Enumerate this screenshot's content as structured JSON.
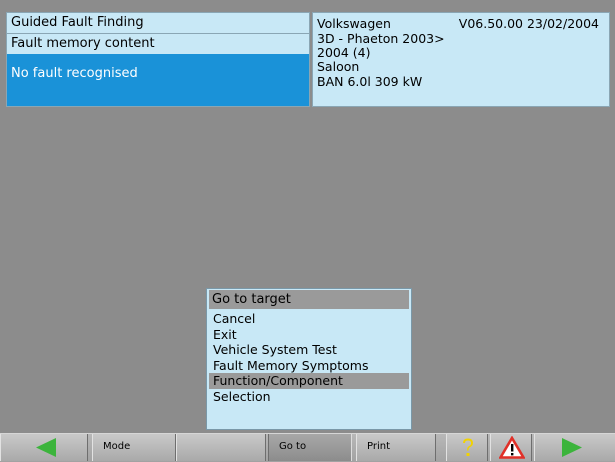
{
  "left_panel": {
    "title": "Guided Fault Finding",
    "subtitle": "Fault memory content",
    "status": "No fault recognised"
  },
  "vehicle_panel": {
    "make": "Volkswagen",
    "version": "V06.50.00 23/02/2004",
    "model": "3D - Phaeton 2003>",
    "year": "2004 (4)",
    "body": "Saloon",
    "engine": "BAN 6.0l 309 kW"
  },
  "menu": {
    "title": "Go to target",
    "items": [
      "Cancel",
      "Exit",
      "Vehicle System Test",
      "Fault Memory Symptoms",
      "Function/Component",
      "Selection"
    ],
    "selected_index": 4
  },
  "toolbar": {
    "back_icon": "left-arrow-icon",
    "mode_label": "Mode",
    "goto_label": "Go to",
    "print_label": "Print",
    "help_icon": "question-mark-icon",
    "warning_icon": "warning-triangle-icon",
    "forward_icon": "right-arrow-icon",
    "arrow_color": "#3cb43c",
    "help_color": "#f2d200",
    "warning_color": "#e03028"
  }
}
